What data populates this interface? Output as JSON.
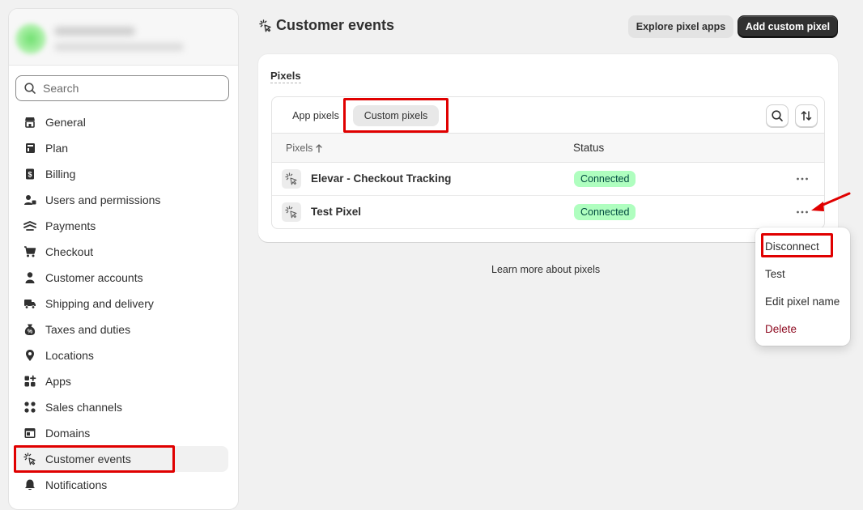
{
  "search": {
    "placeholder": "Search"
  },
  "sidebar": {
    "items": [
      {
        "label": "General",
        "icon": "store-icon"
      },
      {
        "label": "Plan",
        "icon": "plan-icon"
      },
      {
        "label": "Billing",
        "icon": "billing-icon"
      },
      {
        "label": "Users and permissions",
        "icon": "users-icon"
      },
      {
        "label": "Payments",
        "icon": "payments-icon"
      },
      {
        "label": "Checkout",
        "icon": "cart-icon"
      },
      {
        "label": "Customer accounts",
        "icon": "person-icon"
      },
      {
        "label": "Shipping and delivery",
        "icon": "truck-icon"
      },
      {
        "label": "Taxes and duties",
        "icon": "tax-icon"
      },
      {
        "label": "Locations",
        "icon": "location-pin-icon"
      },
      {
        "label": "Apps",
        "icon": "apps-icon"
      },
      {
        "label": "Sales channels",
        "icon": "sales-channels-icon"
      },
      {
        "label": "Domains",
        "icon": "domains-icon"
      },
      {
        "label": "Customer events",
        "icon": "cursor-click-icon",
        "active": true
      },
      {
        "label": "Notifications",
        "icon": "bell-icon"
      }
    ]
  },
  "header": {
    "title": "Customer events",
    "explore_label": "Explore pixel apps",
    "add_label": "Add custom pixel"
  },
  "card": {
    "title": "Pixels",
    "tabs": [
      {
        "label": "App pixels",
        "selected": false
      },
      {
        "label": "Custom pixels",
        "selected": true
      }
    ],
    "columns": {
      "pixels": "Pixels",
      "status": "Status"
    },
    "rows": [
      {
        "name": "Elevar - Checkout Tracking",
        "status": "Connected"
      },
      {
        "name": "Test Pixel",
        "status": "Connected"
      }
    ]
  },
  "learn_more": "Learn more about pixels",
  "menu": {
    "items": [
      {
        "label": "Disconnect"
      },
      {
        "label": "Test"
      },
      {
        "label": "Edit pixel name"
      },
      {
        "label": "Delete",
        "destructive": true
      }
    ]
  },
  "colors": {
    "highlight_red": "#e00000",
    "badge_bg": "#affebf",
    "badge_text": "#014b40",
    "primary_button": "#303030",
    "delete_text": "#8e0b21"
  }
}
